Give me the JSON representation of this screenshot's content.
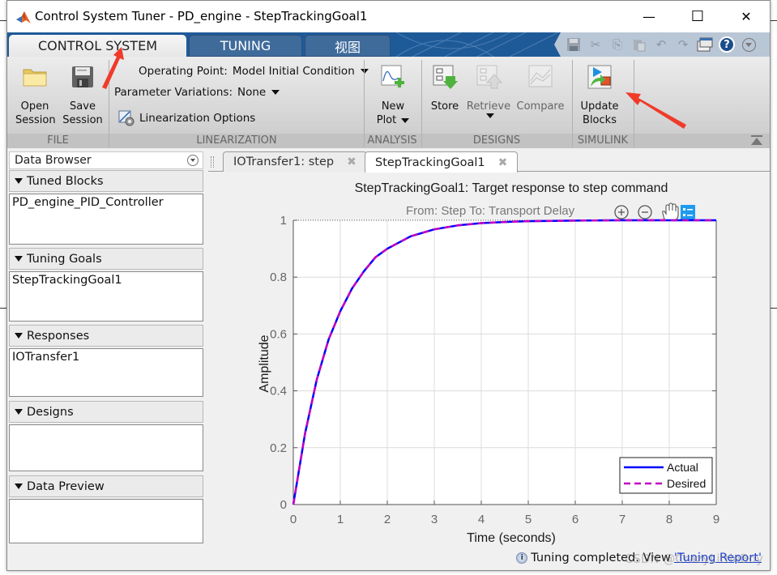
{
  "window": {
    "title": "Control System Tuner - PD_engine - StepTrackingGoal1",
    "minimize_glyph": "—",
    "maximize_glyph": "☐",
    "close_glyph": "✕"
  },
  "ribbon_tabs": [
    {
      "label": "CONTROL SYSTEM",
      "active": true
    },
    {
      "label": "TUNING",
      "active": false
    },
    {
      "label": "视图",
      "active": false
    }
  ],
  "quick_access": [
    {
      "icon": "save-icon",
      "glyph": "💾"
    },
    {
      "icon": "cut-icon",
      "glyph": "✂"
    },
    {
      "icon": "copy-icon",
      "glyph": "⎘"
    },
    {
      "icon": "paste-icon",
      "glyph": "📋"
    },
    {
      "icon": "undo-icon",
      "glyph": "↶"
    },
    {
      "icon": "redo-icon",
      "glyph": "↷"
    },
    {
      "icon": "window-layout-icon",
      "glyph": "▭"
    },
    {
      "icon": "help-icon",
      "glyph": "?"
    },
    {
      "icon": "options-icon",
      "glyph": "▾"
    }
  ],
  "ribbon": {
    "file": {
      "label": "FILE",
      "open_line1": "Open",
      "open_line2": "Session",
      "save_line1": "Save",
      "save_line2": "Session"
    },
    "linearization": {
      "label": "LINEARIZATION",
      "operating_point_label": "Operating Point:",
      "operating_point_value": "Model Initial Condition",
      "param_variations_label": "Parameter Variations:",
      "param_variations_value": "None",
      "options_label": "Linearization Options"
    },
    "analysis": {
      "label": "ANALYSIS",
      "new_plot_line1": "New",
      "new_plot_line2": "Plot"
    },
    "designs": {
      "label": "DESIGNS",
      "store": "Store",
      "retrieve": "Retrieve",
      "compare": "Compare"
    },
    "simulink": {
      "label": "SIMULINK",
      "update_line1": "Update",
      "update_line2": "Blocks"
    }
  },
  "data_browser": {
    "title": "Data Browser",
    "sections": [
      {
        "title": "Tuned Blocks",
        "items": [
          "PD_engine_PID_Controller"
        ]
      },
      {
        "title": "Tuning Goals",
        "items": [
          "StepTrackingGoal1"
        ]
      },
      {
        "title": "Responses",
        "items": [
          "IOTransfer1"
        ]
      },
      {
        "title": "Designs",
        "items": []
      },
      {
        "title": "Data Preview",
        "items": []
      }
    ]
  },
  "document_tabs": [
    {
      "label": "IOTransfer1: step",
      "active": false
    },
    {
      "label": "StepTrackingGoal1",
      "active": true
    }
  ],
  "plot_toolbar": [
    {
      "icon": "zoom-in-icon",
      "glyph": "⊕"
    },
    {
      "icon": "zoom-out-icon",
      "glyph": "⊖"
    },
    {
      "icon": "pan-hand-icon",
      "glyph": "✋"
    },
    {
      "icon": "legend-toggle-icon",
      "glyph": "☷"
    }
  ],
  "status": {
    "text": "Tuning completed. View ",
    "link": "'Tuning Report'",
    "watermark": "CSDN @CrazyLittleBoy"
  },
  "colors": {
    "tabstrip": "#1f5a98",
    "actual": "#0000ff",
    "desired": "#bf00bf",
    "annotation": "#f03a2a"
  },
  "chart_data": {
    "type": "line",
    "title": "StepTrackingGoal1: Target response to step command",
    "subtitle": "From: Step  To: Transport Delay",
    "xlabel": "Time (seconds)",
    "ylabel": "Amplitude",
    "xlim": [
      0,
      9
    ],
    "ylim": [
      0,
      1
    ],
    "xticks": [
      "0",
      "1",
      "2",
      "3",
      "4",
      "5",
      "6",
      "7",
      "8",
      "9"
    ],
    "yticks": [
      "0",
      "0.2",
      "0.4",
      "0.6",
      "0.8",
      "1"
    ],
    "grid": true,
    "legend_position": "bottom-right",
    "x": [
      0,
      0.25,
      0.5,
      0.75,
      1,
      1.25,
      1.5,
      1.75,
      2,
      2.5,
      3,
      3.5,
      4,
      4.5,
      5,
      6,
      7,
      8,
      9
    ],
    "series": [
      {
        "name": "Actual",
        "style": "solid",
        "values": [
          0,
          0.25,
          0.44,
          0.58,
          0.68,
          0.76,
          0.82,
          0.87,
          0.9,
          0.944,
          0.968,
          0.982,
          0.99,
          0.994,
          0.997,
          0.999,
          1.0,
          1.0,
          1.0
        ]
      },
      {
        "name": "Desired",
        "style": "dashed",
        "values": [
          0,
          0.25,
          0.44,
          0.58,
          0.68,
          0.76,
          0.82,
          0.87,
          0.9,
          0.944,
          0.968,
          0.982,
          0.99,
          0.994,
          0.997,
          0.999,
          1.0,
          1.0,
          1.0
        ]
      }
    ]
  }
}
